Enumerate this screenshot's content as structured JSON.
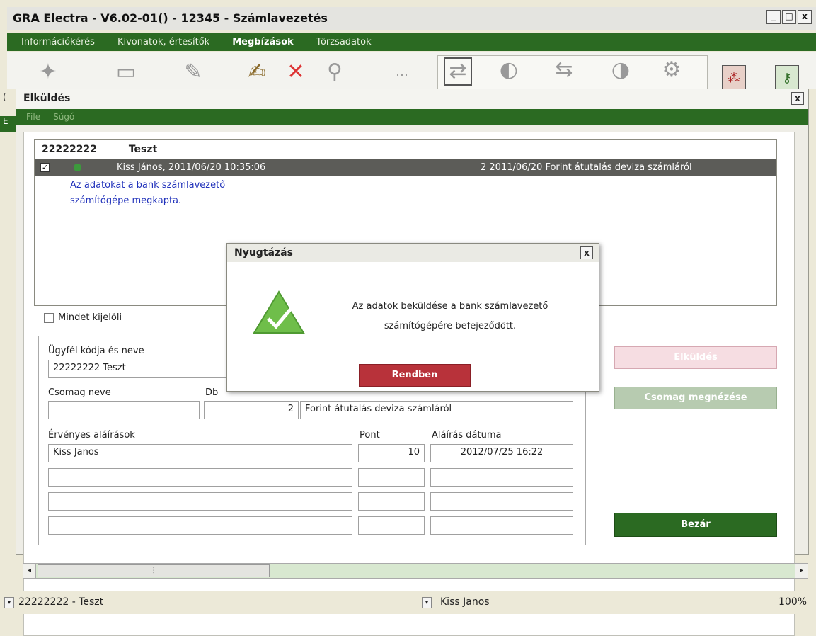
{
  "window": {
    "title": "GRA Electra - V6.02-01() - 12345 - Számlavezetés",
    "min": "_",
    "max": "□",
    "close": "x"
  },
  "menu": {
    "items": [
      "Információkérés",
      "Kivonatok, értesítők",
      "Megbízások",
      "Törzsadatok"
    ],
    "active_index": 2
  },
  "left_strip": {
    "top": "(",
    "bottom": "E"
  },
  "dialog": {
    "title": "Elküldés",
    "close": "x",
    "menu": [
      "File",
      "Súgó"
    ],
    "list": {
      "header_id": "22222222",
      "header_name": "Teszt",
      "row": {
        "checked": "✓",
        "signer": "Kiss János, 2011/06/20 10:35:06",
        "info": "2 2011/06/20  Forint átutalás deviza számláról"
      },
      "message_line1": "Az adatokat a bank számlavezető",
      "message_line2": "számítógépe megkapta."
    },
    "select_all_label": "Mindet kijelöli",
    "form": {
      "client_label": "Ügyfél kódja és neve",
      "client_value": "22222222  Teszt",
      "package_label": "Csomag neve",
      "package_value": "",
      "count_label": "Db",
      "count_value": "2",
      "package_type": "Forint átutalás deviza számláról",
      "signatures_label": "Érvényes aláírások",
      "points_label": "Pont",
      "date_label": "Aláírás dátuma",
      "signatures": [
        {
          "name": "Kiss Janos",
          "points": "10",
          "date": "2012/07/25 16:22"
        },
        {
          "name": "",
          "points": "",
          "date": ""
        },
        {
          "name": "",
          "points": "",
          "date": ""
        },
        {
          "name": "",
          "points": "",
          "date": ""
        }
      ]
    },
    "buttons": {
      "send": "Elküldés",
      "view_package": "Csomag megnézése",
      "close": "Bezár"
    }
  },
  "modal": {
    "title": "Nyugtázás",
    "close": "x",
    "message_line1": "Az adatok beküldése a bank számlavezető",
    "message_line2": "számítógépére befejeződött.",
    "ok": "Rendben"
  },
  "status": {
    "left": "22222222 - Teszt",
    "middle": "Kiss Janos",
    "zoom": "100%"
  },
  "colors": {
    "menu_green": "#2b6a22",
    "ok_red": "#b8323a",
    "dark_green_button": "#2b6a22",
    "pale_pink_button": "#f4d8de",
    "pale_green_button": "#b7cbb0"
  }
}
